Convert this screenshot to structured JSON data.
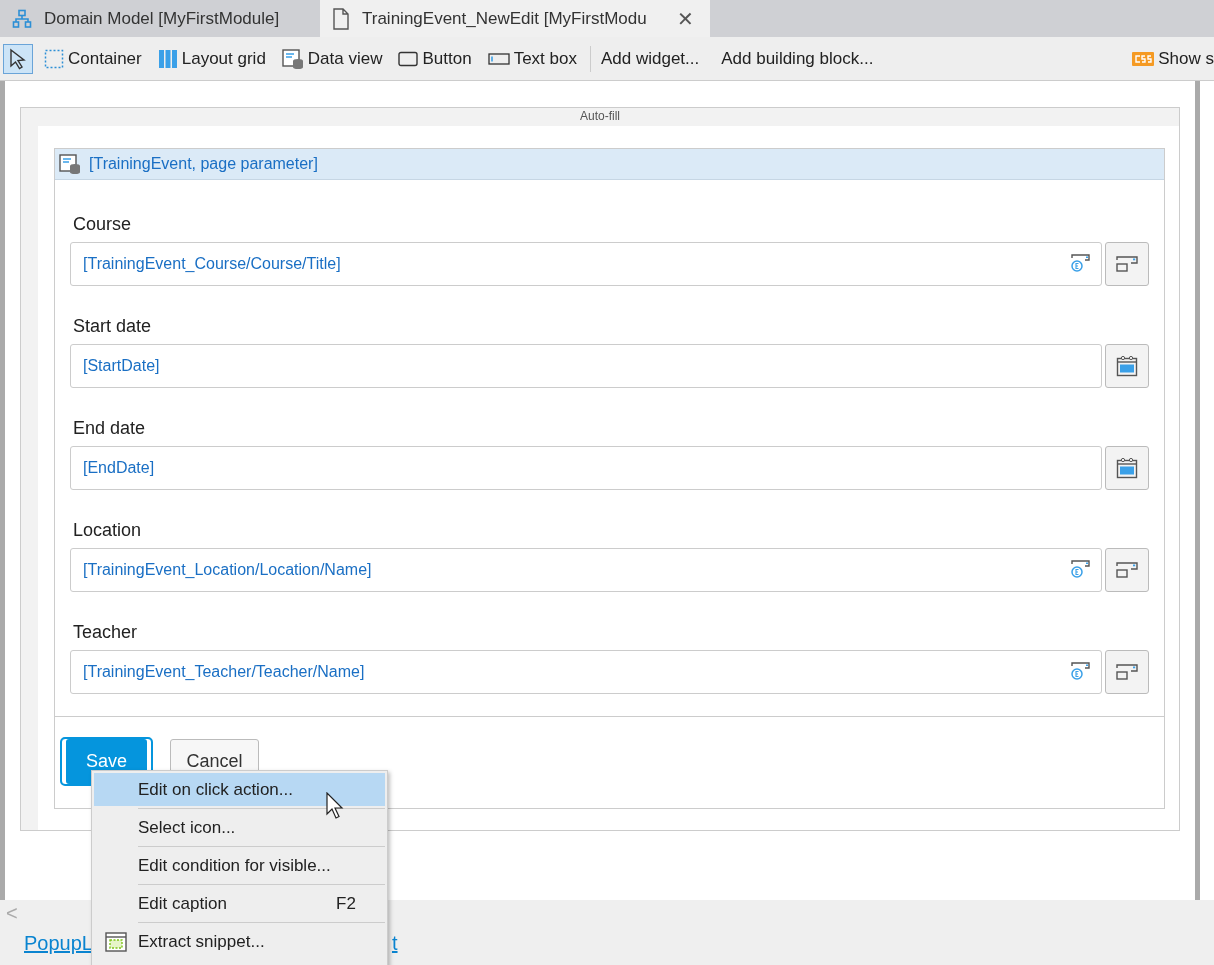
{
  "tabs": [
    {
      "label": "Domain Model [MyFirstModule]",
      "kind": "domain-model",
      "selected": false
    },
    {
      "label": "TrainingEvent_NewEdit [MyFirstModu",
      "kind": "page",
      "selected": true
    }
  ],
  "close_glyph": "✕",
  "toolbar": {
    "tools": [
      {
        "kind": "pointer",
        "selected": true
      },
      {
        "kind": "container",
        "label": "Container",
        "selected": false
      },
      {
        "kind": "layout-grid",
        "label": "Layout grid",
        "selected": false
      },
      {
        "kind": "data-view",
        "label": "Data view",
        "selected": false
      },
      {
        "kind": "button",
        "label": "Button",
        "selected": false
      },
      {
        "kind": "text-box",
        "label": "Text box",
        "selected": false
      }
    ],
    "actions": [
      "Add widget...",
      "Add building block..."
    ],
    "show_styles": "Show s"
  },
  "auto_fill": "Auto-fill",
  "data_view": {
    "title": "[TrainingEvent, page parameter]",
    "fields": [
      {
        "label": "Course",
        "value": "[TrainingEvent_Course/Course/Title]",
        "kind": "reference"
      },
      {
        "label": "Start date",
        "value": "[StartDate]",
        "kind": "date"
      },
      {
        "label": "End date",
        "value": "[EndDate]",
        "kind": "date"
      },
      {
        "label": "Location",
        "value": "[TrainingEvent_Location/Location/Name]",
        "kind": "reference"
      },
      {
        "label": "Teacher",
        "value": "[TrainingEvent_Teacher/Teacher/Name]",
        "kind": "reference"
      }
    ],
    "buttons": [
      {
        "label": "Save",
        "kind": "primary",
        "selected": true
      },
      {
        "label": "Cancel",
        "kind": "default",
        "selected": false
      }
    ]
  },
  "context_menu": [
    {
      "label": "Edit on click action...",
      "kind": "plain",
      "selected": true
    },
    {
      "label": "Select icon...",
      "kind": "plain",
      "selected": false
    },
    {
      "label": "Edit condition for visible...",
      "kind": "plain",
      "selected": false
    },
    {
      "label": "Edit caption",
      "shortcut": "F2",
      "kind": "plain",
      "selected": false
    },
    {
      "label": "Extract snippet...",
      "kind": "snippet",
      "selected": false
    }
  ],
  "bottom": {
    "scroll_glyph": "<",
    "links": [
      "PopupL",
      "t"
    ]
  }
}
